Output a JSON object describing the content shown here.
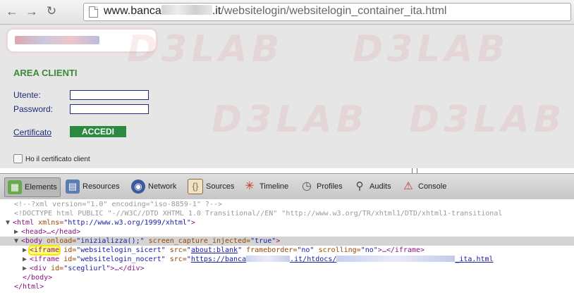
{
  "browser": {
    "url_prefix": "www.banca",
    "url_suffix": ".it",
    "url_path": "/websitelogin/websitelogin_container_ita.html"
  },
  "page": {
    "title": "AREA CLIENTI",
    "username_label": "Utente:",
    "password_label": "Password:",
    "certificate_link": "Certificato",
    "login_button": "ACCEDI",
    "client_cert_checkbox_label": "Ho il certificato client"
  },
  "watermark": "D3LAB",
  "devtools": {
    "tabs": [
      {
        "label": "Elements",
        "icon": "elements-icon",
        "color": "#6aa84f"
      },
      {
        "label": "Resources",
        "icon": "resources-icon",
        "color": "#5b7db1"
      },
      {
        "label": "Network",
        "icon": "network-icon",
        "color": "#3d5a9e"
      },
      {
        "label": "Sources",
        "icon": "sources-icon",
        "color": "#8a6b3e"
      },
      {
        "label": "Timeline",
        "icon": "timeline-icon",
        "color": "#c0392b"
      },
      {
        "label": "Profiles",
        "icon": "profiles-icon",
        "color": "#7f8c8d"
      },
      {
        "label": "Audits",
        "icon": "audits-icon",
        "color": "#5a5a5a"
      },
      {
        "label": "Console",
        "icon": "console-icon",
        "color": "#c0392b"
      }
    ],
    "source": {
      "l1": "<!--?xml version=\"1.0\" encoding=\"iso-8859-1\" ?-->",
      "l2": "<!DOCTYPE html PUBLIC \"-//W3C//DTD XHTML 1.0 Transitional//EN\" \"http://www.w3.org/TR/xhtml1/DTD/xhtml1-transitional",
      "html_open": "<html",
      "xmlns_attr": " xmlns=",
      "xmlns_val": "\"http://www.w3.org/1999/xhtml\"",
      "gt": ">",
      "head": "<head>…</head>",
      "body_open": "<body",
      "onload_attr": " onload=",
      "onload_val": "\"inizializza();\"",
      "sci_attr": " screen_capture_injected=",
      "sci_val": "\"true\"",
      "iframe_tag": "<iframe",
      "id_attr": " id=",
      "id1_val": "\"websitelogin_sicert\"",
      "src_attr": " src=",
      "src1_q1": "\"",
      "src1_link": "about:blank",
      "src1_q2": "\"",
      "fb_attr": " frameborder=",
      "fb_val": "\"no\"",
      "sc_attr": " scrolling=",
      "sc_val": "\"no\"",
      "iframe_close": ">…</iframe>",
      "id2_val": "\"websitelogin_nocert\"",
      "src2_q1": "\"",
      "src2_a": "https://banca",
      "src2_b": ".it/htdocs/",
      "src2_c": "_ita.html",
      "div_open": "<div",
      "id3_val": "\"scegliurl\"",
      "div_close": ">…</div>",
      "body_close": "</body>",
      "html_close": "</html>"
    }
  }
}
